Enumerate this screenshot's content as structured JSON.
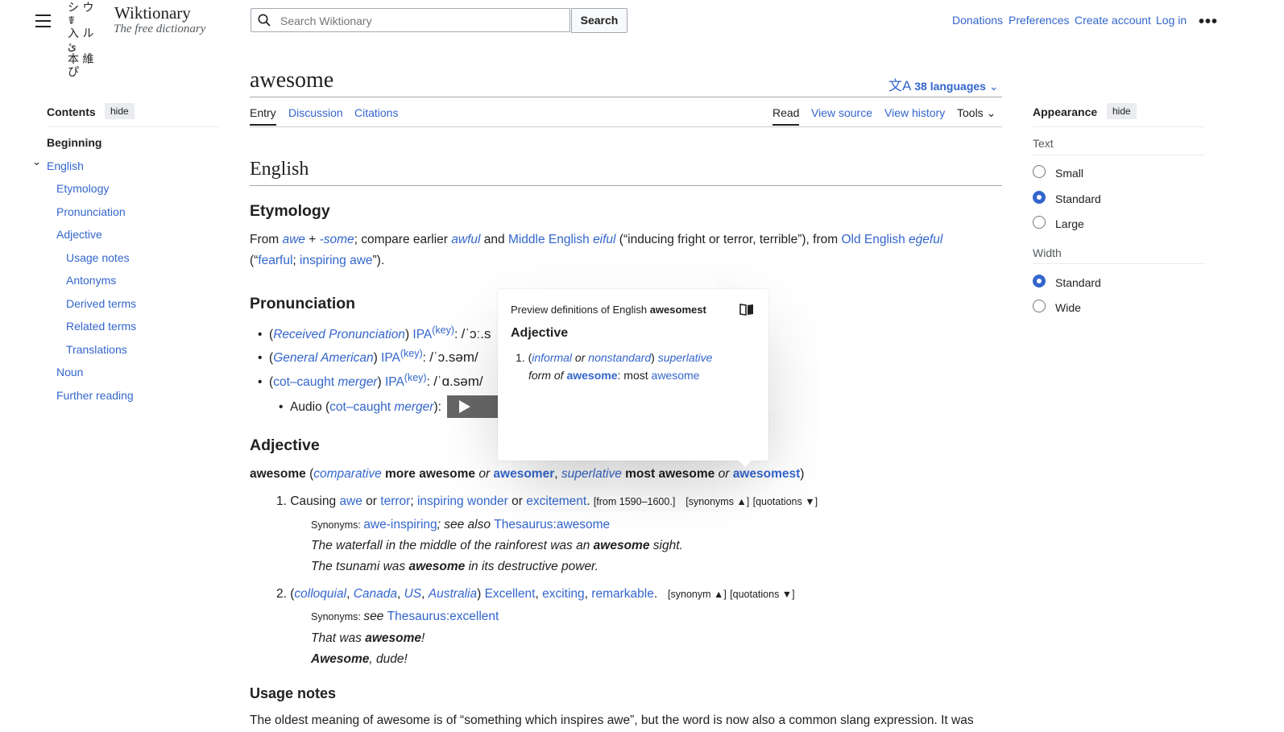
{
  "header": {
    "logo_glyphs": [
      "シ ウ ﻿ ☤",
      "入 ル ﻿ ئ",
      "本 維 ぴ"
    ],
    "logo_title": "Wiktionary",
    "logo_tagline": "The free dictionary",
    "search_placeholder": "Search Wiktionary",
    "search_button": "Search",
    "links": [
      "Donations",
      "Preferences",
      "Create account",
      "Log in"
    ],
    "more": "•••"
  },
  "page": {
    "title": "awesome",
    "languages": "38 languages",
    "left_tabs": [
      "Entry",
      "Discussion",
      "Citations"
    ],
    "right_tabs": [
      "Read",
      "View source",
      "View history",
      "Tools"
    ]
  },
  "toc": {
    "title": "Contents",
    "hide": "hide",
    "items": [
      "Beginning",
      "English",
      "Etymology",
      "Pronunciation",
      "Adjective",
      "Usage notes",
      "Antonyms",
      "Derived terms",
      "Related terms",
      "Translations",
      "Noun",
      "Further reading"
    ]
  },
  "appearance": {
    "title": "Appearance",
    "hide": "hide",
    "text_label": "Text",
    "text_options": [
      "Small",
      "Standard",
      "Large"
    ],
    "width_label": "Width",
    "width_options": [
      "Standard",
      "Wide"
    ]
  },
  "content": {
    "lang_heading": "English",
    "etym_heading": "Etymology",
    "etym": {
      "from": "From ",
      "awe": "awe",
      "plus": " + ",
      "some": "-some",
      "compare": "; compare earlier ",
      "awful": "awful",
      "and": " and ",
      "middle_english": "Middle English",
      "eiful": "eiful",
      "gloss1": " (“inducing fright or terror, terrible”), from ",
      "old_english": "Old English",
      "egeful": "eġeful",
      "open": "(“",
      "fearful": "fearful",
      "semi": "; ",
      "inspiring_awe": "inspiring awe",
      "close": "”)."
    },
    "pron_heading": "Pronunciation",
    "pron": [
      {
        "open": "(",
        "accent": "Received Pronunciation",
        "close": ") ",
        "ipa": "IPA",
        "key": "(key)",
        "colon": ": ",
        "value": "/ˈɔː.s"
      },
      {
        "open": "(",
        "accent": "General American",
        "close": ") ",
        "ipa": "IPA",
        "key": "(key)",
        "colon": ": ",
        "value": "/ˈɔ.səm/"
      },
      {
        "open": "(",
        "accent1": "cot–caught",
        "accent2": "merger",
        "close": ") ",
        "ipa": "IPA",
        "key": "(key)",
        "colon": ": ",
        "value": "/ˈɑ.səm/"
      }
    ],
    "audio": {
      "label": "Audio (",
      "accent1": "cot–caught",
      "accent2": "merger",
      "close": "):"
    },
    "adj_heading": "Adjective",
    "headword": {
      "word": "awesome",
      "open": " (",
      "comparative": "comparative",
      "more": " more awesome",
      "or1": " or ",
      "awesomer": "awesomer",
      "comma": ", ",
      "superlative": "superlative",
      "most": " most awesome",
      "or2": " or ",
      "awesomest": "awesomest",
      "close": ")"
    },
    "sense1": {
      "num": "1.",
      "causing": "Causing ",
      "awe": "awe",
      "or1": " or ",
      "terror": "terror",
      "semi": "; ",
      "inspiring": "inspiring",
      "wonder": "wonder",
      "or2": " or ",
      "excitement": "excitement",
      "dot": ".",
      "date": "[from 1590–1600.]",
      "synonyms_btn": "[synonyms ▲]",
      "quotations_btn": "[quotations ▼]",
      "syn_label": "Synonyms: ",
      "syn1": "awe-inspiring",
      "see_also": "; see also ",
      "syn2": "Thesaurus:awesome",
      "ex1a": "The waterfall in the middle of the rainforest was an ",
      "ex1b": "awesome",
      "ex1c": " sight.",
      "ex2a": "The tsunami was ",
      "ex2b": "awesome",
      "ex2c": " in its destructive power."
    },
    "sense2": {
      "num": "2.",
      "open": "(",
      "colloquial": "colloquial",
      "c1": ", ",
      "canada": "Canada",
      "c2": ", ",
      "us": "US",
      "c3": ", ",
      "australia": "Australia",
      "close": ") ",
      "excellent": "Excellent",
      "c4": ", ",
      "exciting": "exciting",
      "c5": ", ",
      "remarkable": "remarkable",
      "dot": ".",
      "synonym_btn": "[synonym ▲]",
      "quotations_btn": "[quotations ▼]",
      "syn_label": "Synonyms: ",
      "see": "see ",
      "syn1": "Thesaurus:excellent",
      "ex1a": "That was ",
      "ex1b": "awesome",
      "ex1c": "!",
      "ex2a": "Awesome",
      "ex2b": ", dude!"
    },
    "usage_heading": "Usage notes",
    "usage_partial": "The oldest meaning of awesome is of “something which inspires awe”, but the word is now also a common slang expression. It was"
  },
  "popup": {
    "preview_prefix": "Preview definitions of English ",
    "preview_word": "awesomest",
    "heading": "Adjective",
    "num": "1.",
    "open": "(",
    "informal": "informal",
    "or": " or ",
    "nonstandard": "nonstandard",
    "close": ") ",
    "superlative": "superlative",
    "form_of": "form of ",
    "awesome": "awesome",
    "most": ": most ",
    "awesome2": "awesome"
  },
  "colors": {
    "link": "#3366cc",
    "text": "#202122",
    "border": "#a2a9b1"
  }
}
